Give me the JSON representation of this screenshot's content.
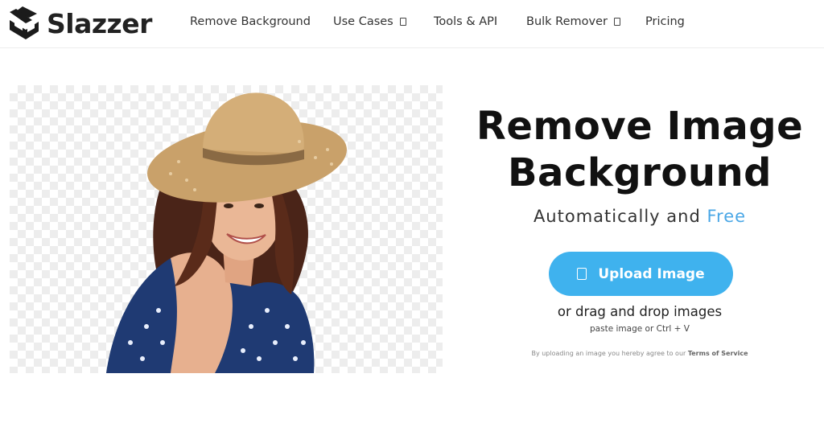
{
  "brand": {
    "name": "Slazzer"
  },
  "nav": {
    "items": [
      {
        "label": "Remove Background"
      },
      {
        "label": "Use Cases",
        "has_dropdown": true
      },
      {
        "label": "Tools & API"
      },
      {
        "label": "Bulk Remover",
        "has_dropdown": true
      },
      {
        "label": "Pricing"
      }
    ]
  },
  "hero": {
    "headline_line1": "Remove Image",
    "headline_line2": "Background",
    "subhead_prefix": "Automatically and",
    "subhead_highlight": "Free",
    "upload_label": "Upload Image",
    "upload_icon": "upload-icon",
    "drag_text": "or drag and drop images",
    "paste_text": "paste image or Ctrl + V",
    "terms_prefix": "By uploading an image you hereby agree to our",
    "terms_link": "Terms of Service"
  },
  "colors": {
    "accent": "#3fb2ee",
    "free_text": "#4aa7e6",
    "headline": "#111111"
  }
}
